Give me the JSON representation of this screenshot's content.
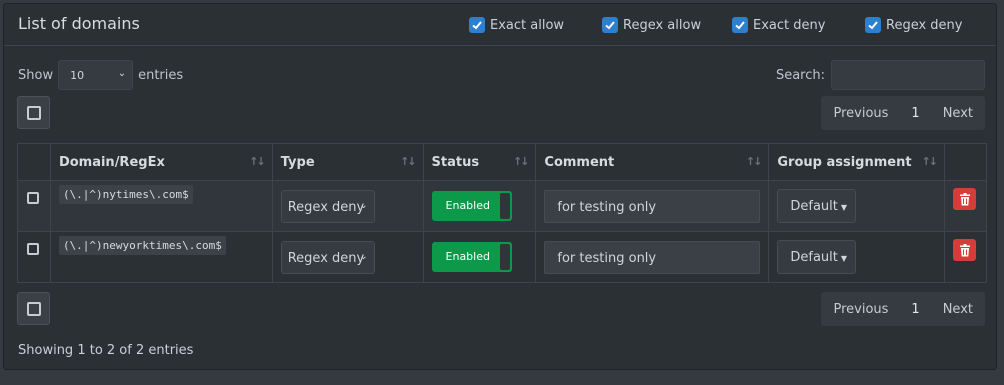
{
  "title": "List of domains",
  "filters": [
    {
      "label": "Exact allow",
      "checked": true
    },
    {
      "label": "Regex allow",
      "checked": true
    },
    {
      "label": "Exact deny",
      "checked": true
    },
    {
      "label": "Regex deny",
      "checked": true
    }
  ],
  "length": {
    "show_label": "Show",
    "value": "10",
    "entries_label": "entries"
  },
  "search": {
    "label": "Search:",
    "placeholder": ""
  },
  "pager": {
    "previous": "Previous",
    "page": "1",
    "next": "Next"
  },
  "columns": [
    "Domain/RegEx",
    "Type",
    "Status",
    "Comment",
    "Group assignment"
  ],
  "rows": [
    {
      "domain": "(\\.|^)nytimes\\.com$",
      "type": "Regex deny",
      "status": "Enabled",
      "comment": "for testing only",
      "group": "Default"
    },
    {
      "domain": "(\\.|^)newyorktimes\\.com$",
      "type": "Regex deny",
      "status": "Enabled",
      "comment": "for testing only",
      "group": "Default"
    }
  ],
  "info": "Showing 1 to 2 of 2 entries",
  "colors": {
    "accent": "#2f7fcf",
    "enabled": "#0c9a4a",
    "danger": "#d33d3a"
  }
}
